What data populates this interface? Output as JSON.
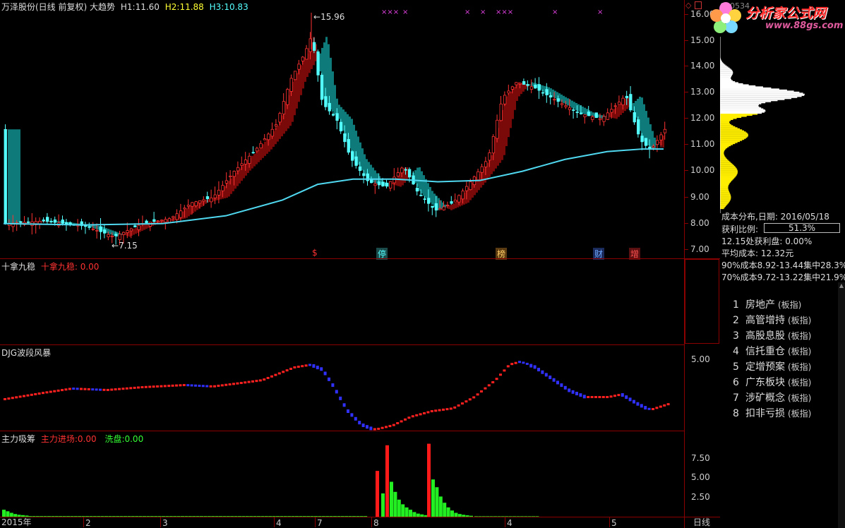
{
  "main": {
    "stock_name": "万泽股份(日线 前复权)",
    "indicator": "大趋势",
    "h1_label": "H1:",
    "h1_value": "11.60",
    "h2_label": "H2:",
    "h2_value": "11.88",
    "h3_label": "H3:",
    "h3_value": "10.83",
    "high_annotation": "15.96",
    "low_annotation": "7.15",
    "price_ticks": [
      "16.00",
      "15.00",
      "14.00",
      "13.00",
      "12.00",
      "11.00",
      "10.00",
      "9.00",
      "8.00",
      "7.00"
    ],
    "stock_code": "000534",
    "event_marks": [
      "$",
      "停",
      "榜",
      "财",
      "增"
    ]
  },
  "panel2": {
    "title": "十拿九稳",
    "label": "十拿九稳:",
    "value": "0.00"
  },
  "panel3": {
    "title": "DJG波段风暴",
    "tick": "5.00"
  },
  "panel4": {
    "title": "主力吸筹",
    "label1": "主力进场:",
    "value1": "0.00",
    "label2": "洗盘:",
    "value2": "0.00",
    "ticks": [
      "7.50",
      "5.00",
      "2.50"
    ]
  },
  "xaxis": {
    "year": "2015年",
    "months": [
      "2",
      "3",
      "4",
      "7",
      "8",
      "4",
      "5"
    ],
    "period": "日线"
  },
  "watermark": {
    "title": "分析家公式网",
    "url": "www.88gs.com"
  },
  "chip": {
    "title": "成本分布,日期: 2016/05/18",
    "profit_label": "获利比例:",
    "profit_value": "51.3%",
    "at_price": "12.15处获利盘: 0.00%",
    "avg_cost": "平均成本: 12.32元",
    "c90": "90%成本8.92-13.44集中28.3%",
    "c70": "70%成本9.72-13.22集中21.9%"
  },
  "sectors": [
    {
      "num": "1",
      "name": "房地产",
      "tag": "(板指)"
    },
    {
      "num": "2",
      "name": "高管增持",
      "tag": "(板指)"
    },
    {
      "num": "3",
      "name": "高股息股",
      "tag": "(板指)"
    },
    {
      "num": "4",
      "name": "信托重仓",
      "tag": "(板指)"
    },
    {
      "num": "5",
      "name": "定增预案",
      "tag": "(板指)"
    },
    {
      "num": "6",
      "name": "广东板块",
      "tag": "(板指)"
    },
    {
      "num": "7",
      "name": "涉矿概念",
      "tag": "(板指)"
    },
    {
      "num": "8",
      "name": "扣非亏损",
      "tag": "(板指)"
    }
  ],
  "colors": {
    "up": "#ff3232",
    "down": "#54ffff",
    "ribbon_up": "#7a0a0a",
    "ribbon_down": "#0f7a7a",
    "ma": "#4fd8ef",
    "border": "#8b0000"
  }
}
